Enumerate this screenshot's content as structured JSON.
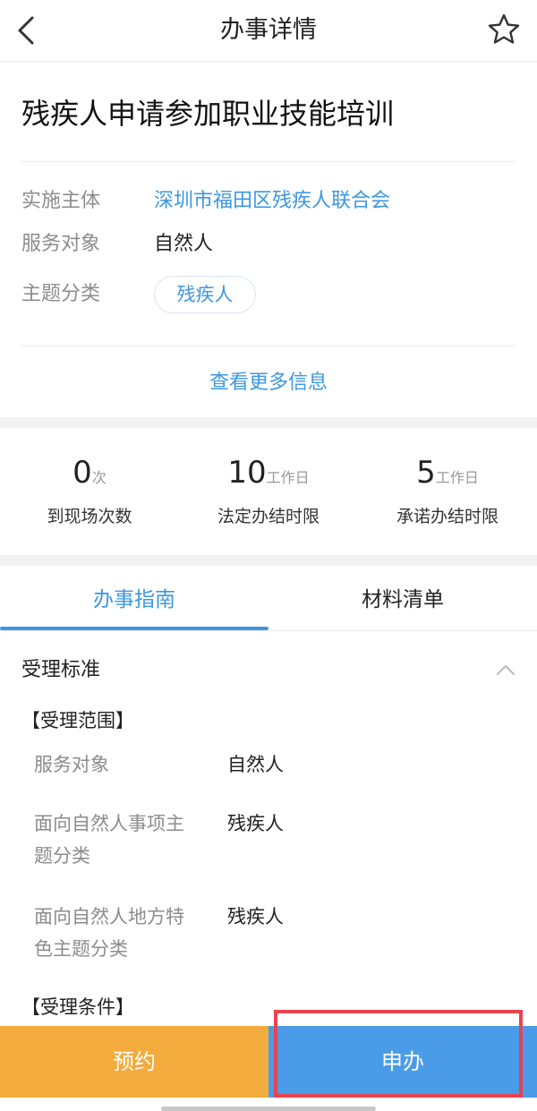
{
  "header": {
    "title": "办事详情",
    "back_icon": "chevron-left-icon",
    "favorite_icon": "star-outline-icon"
  },
  "item": {
    "title": "残疾人申请参加职业技能培训",
    "fields": [
      {
        "label": "实施主体",
        "value": "深圳市福田区残疾人联合会"
      },
      {
        "label": "服务对象",
        "value": "自然人"
      },
      {
        "label": "主题分类",
        "value": "残疾人"
      }
    ],
    "more_info": "查看更多信息"
  },
  "stats": [
    {
      "number": "0",
      "unit": "次",
      "label": "到现场次数"
    },
    {
      "number": "10",
      "unit": "工作日",
      "label": "法定办结时限"
    },
    {
      "number": "5",
      "unit": "工作日",
      "label": "承诺办结时限"
    }
  ],
  "tabs": [
    {
      "label": "办事指南",
      "active": true
    },
    {
      "label": "材料清单",
      "active": false
    }
  ],
  "guide": {
    "section_title": "受理标准",
    "scope_heading": "【受理范围】",
    "rows": [
      {
        "label": "服务对象",
        "value": "自然人"
      },
      {
        "label": "面向自然人事项主题分类",
        "value": "残疾人"
      },
      {
        "label": "面向自然人地方特色主题分类",
        "value": "残疾人"
      }
    ],
    "condition_heading": "【受理条件】"
  },
  "actions": {
    "reserve": "预约",
    "apply": "申办"
  },
  "colors": {
    "accent": "#3d97e0",
    "reserve_button": "#f2ab3c",
    "apply_button": "#4b9ce8",
    "highlight": "#e8434f"
  }
}
